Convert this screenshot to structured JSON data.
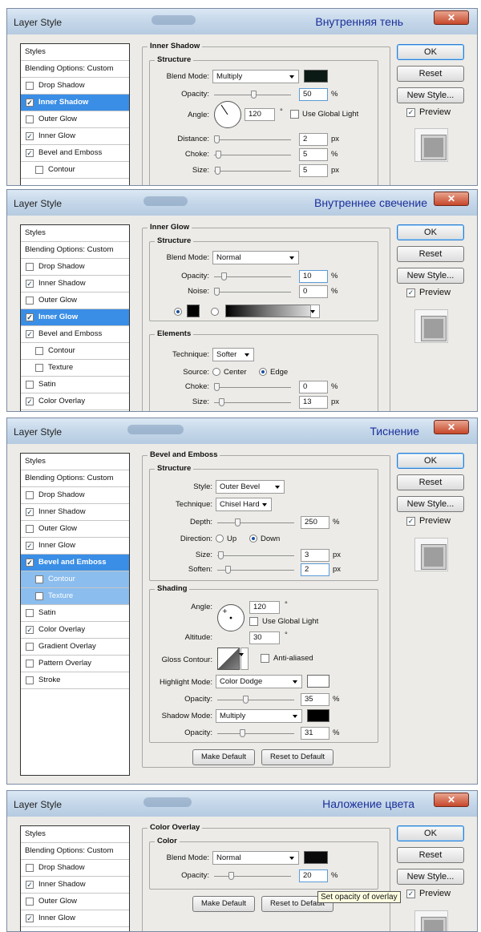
{
  "common": {
    "dialog_title": "Layer Style",
    "close_glyph": "✕",
    "styles_header": "Styles",
    "blending_options": "Blending Options: Custom",
    "ok": "OK",
    "reset": "Reset",
    "new_style": "New Style...",
    "preview": "Preview"
  },
  "panel1": {
    "russian_title": "Внутренняя тень",
    "styles": [
      {
        "label": "Drop Shadow",
        "checked": false
      },
      {
        "label": "Inner Shadow",
        "checked": true
      },
      {
        "label": "Outer Glow",
        "checked": false
      },
      {
        "label": "Inner Glow",
        "checked": true
      },
      {
        "label": "Bevel and Emboss",
        "checked": true
      },
      {
        "label": "Contour",
        "checked": false
      }
    ],
    "section": "Inner Shadow",
    "structure": "Structure",
    "blend_mode_label": "Blend Mode:",
    "blend_mode": "Multiply",
    "color": "#0b1a14",
    "opacity_label": "Opacity:",
    "opacity": "50",
    "opacity_pct": 0.5,
    "angle_label": "Angle:",
    "angle": "120",
    "degree": "°",
    "global_light": "Use Global Light",
    "distance_label": "Distance:",
    "distance": "2",
    "choke_label": "Choke:",
    "choke": "5",
    "size_label": "Size:",
    "size": "5",
    "px": "px",
    "pct": "%"
  },
  "panel2": {
    "russian_title": "Внутреннее свечение",
    "styles": [
      {
        "label": "Drop Shadow",
        "checked": false
      },
      {
        "label": "Inner Shadow",
        "checked": true
      },
      {
        "label": "Outer Glow",
        "checked": false
      },
      {
        "label": "Inner Glow",
        "checked": true
      },
      {
        "label": "Bevel and Emboss",
        "checked": true
      },
      {
        "label": "Contour",
        "checked": false
      },
      {
        "label": "Texture",
        "checked": false
      },
      {
        "label": "Satin",
        "checked": false
      },
      {
        "label": "Color Overlay",
        "checked": true
      }
    ],
    "section": "Inner Glow",
    "structure": "Structure",
    "blend_mode_label": "Blend Mode:",
    "blend_mode": "Normal",
    "opacity_label": "Opacity:",
    "opacity": "10",
    "noise_label": "Noise:",
    "noise": "0",
    "pct": "%",
    "elements": "Elements",
    "technique_label": "Technique:",
    "technique": "Softer",
    "source_label": "Source:",
    "center": "Center",
    "edge": "Edge",
    "choke_label": "Choke:",
    "choke": "0",
    "size_label": "Size:",
    "size": "13",
    "px": "px"
  },
  "panel3": {
    "russian_title": "Тиснение",
    "styles": [
      {
        "label": "Drop Shadow",
        "checked": false
      },
      {
        "label": "Inner Shadow",
        "checked": true
      },
      {
        "label": "Outer Glow",
        "checked": false
      },
      {
        "label": "Inner Glow",
        "checked": true
      },
      {
        "label": "Bevel and Emboss",
        "checked": true
      },
      {
        "label": "Contour",
        "checked": false
      },
      {
        "label": "Texture",
        "checked": false
      },
      {
        "label": "Satin",
        "checked": false
      },
      {
        "label": "Color Overlay",
        "checked": true
      },
      {
        "label": "Gradient Overlay",
        "checked": false
      },
      {
        "label": "Pattern Overlay",
        "checked": false
      },
      {
        "label": "Stroke",
        "checked": false
      }
    ],
    "section": "Bevel and Emboss",
    "structure": "Structure",
    "style_label": "Style:",
    "style": "Outer Bevel",
    "technique_label": "Technique:",
    "technique": "Chisel Hard",
    "depth_label": "Depth:",
    "depth": "250",
    "direction_label": "Direction:",
    "up": "Up",
    "down": "Down",
    "size_label": "Size:",
    "size": "3",
    "soften_label": "Soften:",
    "soften": "2",
    "px": "px",
    "pct": "%",
    "shading": "Shading",
    "angle_label": "Angle:",
    "angle": "120",
    "degree": "°",
    "global_light": "Use Global Light",
    "altitude_label": "Altitude:",
    "altitude": "30",
    "gloss_label": "Gloss Contour:",
    "anti_aliased": "Anti-aliased",
    "highlight_label": "Highlight Mode:",
    "highlight_mode": "Color Dodge",
    "highlight_color": "#ffffff",
    "h_opacity_label": "Opacity:",
    "h_opacity": "35",
    "shadow_label": "Shadow Mode:",
    "shadow_mode": "Multiply",
    "shadow_color": "#000000",
    "s_opacity_label": "Opacity:",
    "s_opacity": "31",
    "make_default": "Make Default",
    "reset_default": "Reset to Default"
  },
  "panel4": {
    "russian_title": "Наложение цвета",
    "styles": [
      {
        "label": "Drop Shadow",
        "checked": false
      },
      {
        "label": "Inner Shadow",
        "checked": true
      },
      {
        "label": "Outer Glow",
        "checked": false
      },
      {
        "label": "Inner Glow",
        "checked": true
      }
    ],
    "section": "Color Overlay",
    "color_group": "Color",
    "blend_mode_label": "Blend Mode:",
    "blend_mode": "Normal",
    "color": "#0a0a0a",
    "opacity_label": "Opacity:",
    "opacity": "20",
    "pct": "%",
    "make_default": "Make Default",
    "reset_default": "Reset to Default",
    "tooltip": "Set opacity of overlay"
  }
}
